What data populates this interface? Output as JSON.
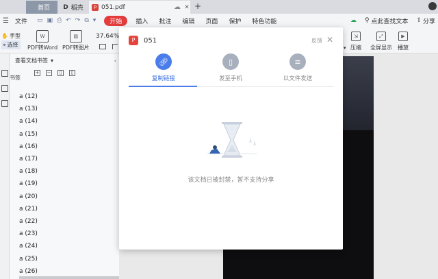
{
  "tabs": {
    "home": "首页",
    "daoke": "稻壳",
    "pdf": "051.pdf"
  },
  "menu": {
    "file": "文件",
    "items": [
      "开始",
      "插入",
      "批注",
      "编辑",
      "页面",
      "保护",
      "特色功能"
    ],
    "search": "点此查找文本",
    "share": "分享"
  },
  "toolbar": {
    "hand": "手型",
    "select": "选择",
    "pdf_to_word": "PDF转Word",
    "pdf_to_image": "PDF转图片",
    "zoom": "37.64%",
    "compress": "压缩",
    "fullscreen": "全屏显示",
    "play": "播放"
  },
  "sidebar": {
    "header": "查看文档书签",
    "title": "书签",
    "bookmarks": [
      "a (12)",
      "a (13)",
      "a (14)",
      "a (15)",
      "a (16)",
      "a (17)",
      "a (18)",
      "a (19)",
      "a (20)",
      "a (21)",
      "a (22)",
      "a (23)",
      "a (24)",
      "a (25)",
      "a (26)"
    ]
  },
  "modal": {
    "title": "051",
    "feedback": "反馈",
    "options": [
      "复制链接",
      "发至手机",
      "以文件发送"
    ],
    "empty_message": "该文档已被封禁，暂不支持分享"
  },
  "colors": {
    "accent": "#4a7de9",
    "brand_red": "#e23c3c",
    "tab_home_bg": "#8c97a8"
  }
}
